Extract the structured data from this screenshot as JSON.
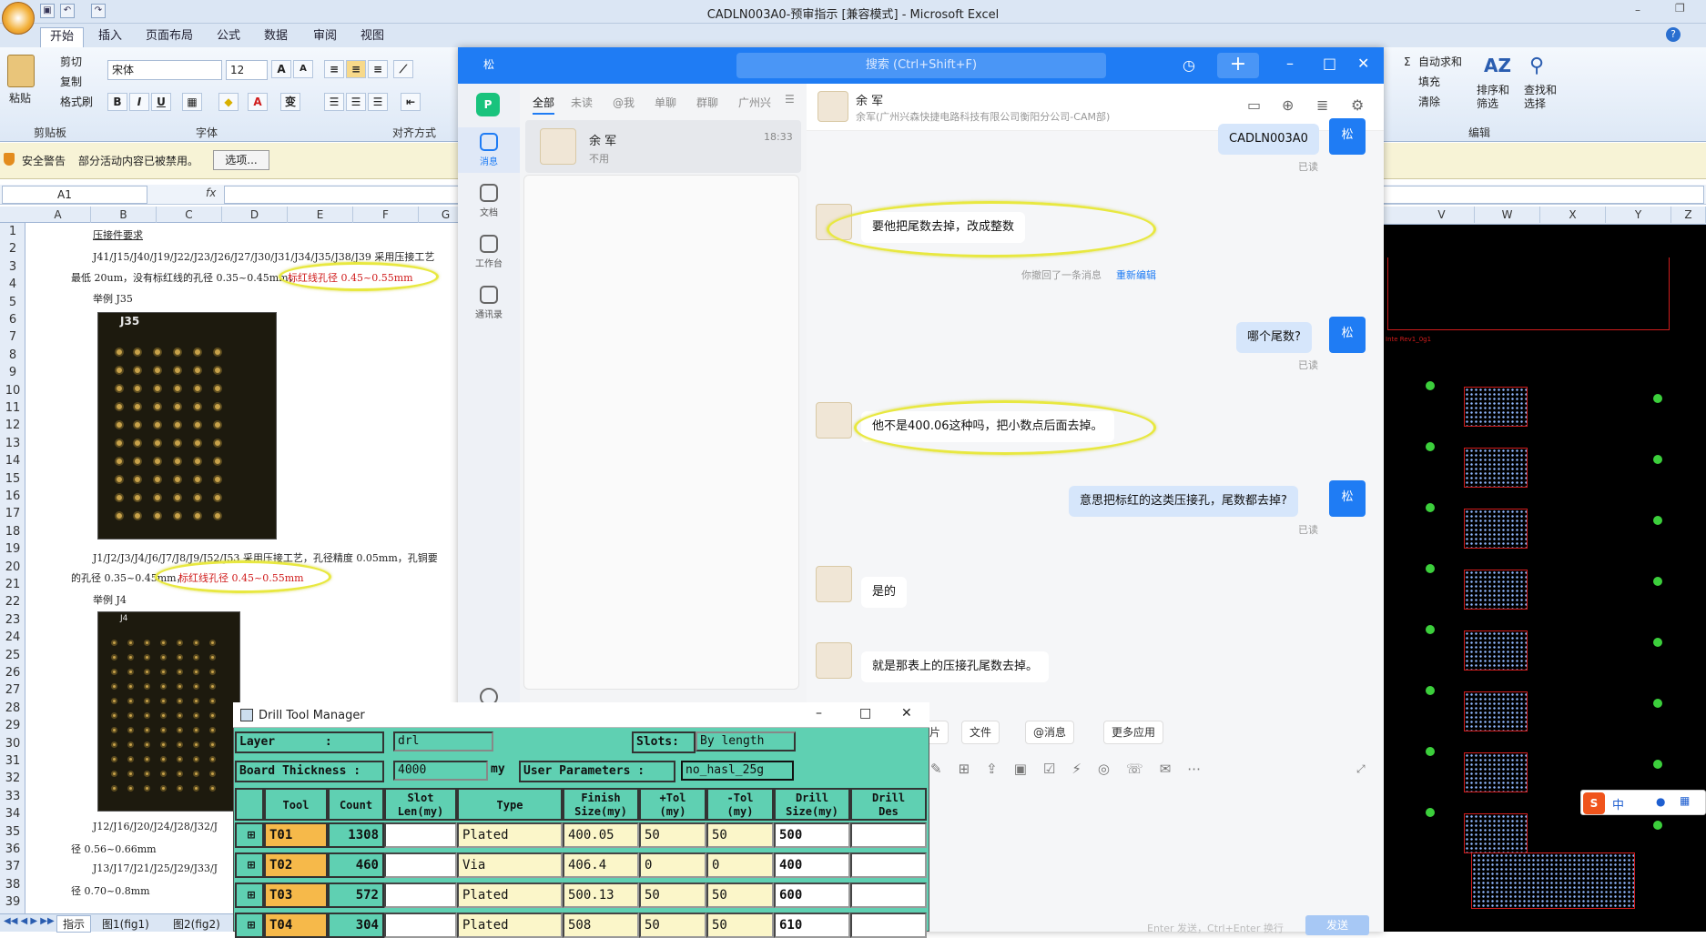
{
  "excel": {
    "title": "CADLN003A0-预审指示 [兼容模式] - Microsoft Excel",
    "tabs": [
      "开始",
      "插入",
      "页面布局",
      "公式",
      "数据",
      "审阅",
      "视图"
    ],
    "clipboard": {
      "paste": "粘贴",
      "cut": "剪切",
      "copy": "复制",
      "painter": "格式刷",
      "group": "剪贴板"
    },
    "font": {
      "name": "宋体",
      "size": "12",
      "group": "字体"
    },
    "align_group": "对齐方式",
    "editing": {
      "autosum": "自动求和",
      "fill": "填充",
      "clear": "清除",
      "sort": "排序和\n筛选",
      "find": "查找和\n选择",
      "group": "编辑"
    },
    "security": {
      "label": "安全警告",
      "msg": "部分活动内容已被禁用。",
      "btn": "选项..."
    },
    "namebox": "A1",
    "fx": "fx",
    "columns": [
      "A",
      "B",
      "C",
      "D",
      "E",
      "F",
      "G"
    ],
    "right_columns": [
      "V",
      "W",
      "X",
      "Y",
      "Z"
    ],
    "rows": [
      "1",
      "2",
      "3",
      "4",
      "5",
      "6",
      "7",
      "8",
      "9",
      "10",
      "11",
      "12",
      "13",
      "14",
      "15",
      "16",
      "17",
      "18",
      "19",
      "20",
      "21",
      "22",
      "23",
      "24",
      "25",
      "26",
      "27",
      "28",
      "29",
      "30",
      "31",
      "32",
      "33",
      "34",
      "35",
      "36",
      "37",
      "38",
      "39"
    ],
    "cells": {
      "r1": "压接件要求",
      "r2": "J41/J15/J40/J19/J22/J23/J26/J27/J30/J31/J34/J35/J38/J39 采用压接工艺",
      "r3a": "最低 20um，没有标红线的孔径 0.35~0.45mm，",
      "r3b": "标红线孔径 0.45~0.55mm",
      "r4": "举例 J35",
      "r19": "J1/J2/J3/J4/J6/J7/J8/J9/J52/J53 采用压接工艺，孔径精度 0.05mm，孔铜要",
      "r20a": "的孔径 0.35~0.45mm，",
      "r20b": "标红线孔径 0.45~0.55mm",
      "r21": "举例 J4",
      "r35": "J12/J16/J20/J24/J28/J32/J",
      "r36": "径 0.56~0.66mm",
      "r37": "J13/J17/J21/J25/J29/J33/J",
      "r38": "径 0.70~0.8mm"
    },
    "pcb1_label": "J35",
    "pcb2_label": "J4",
    "sheets": [
      "指示",
      "图1(fig1)",
      "图2(fig2)"
    ]
  },
  "chat": {
    "search_placeholder": "搜索 (Ctrl+Shift+F)",
    "logo": "松",
    "nav": [
      "消息",
      "文档",
      "工作台",
      "通讯录"
    ],
    "list_tabs": [
      "全部",
      "未读",
      "@我",
      "单聊",
      "群聊",
      "广州兴"
    ],
    "contact": {
      "name": "余 军",
      "preview": "不用",
      "time": "18:33"
    },
    "header": {
      "name": "余 军",
      "org": "余军(广州兴森快捷电路科技有限公司衡阳分公司-CAM部)"
    },
    "messages": [
      {
        "from": "me",
        "text": "CADLN003A0",
        "status": "已读"
      },
      {
        "from": "other",
        "text": "要他把尾数去掉，改成整数"
      },
      {
        "from": "system",
        "text": "你撤回了一条消息",
        "link": "重新编辑"
      },
      {
        "from": "me",
        "text": "哪个尾数?",
        "status": "已读"
      },
      {
        "from": "other",
        "text": "他不是400.06这种吗，把小数点后面去掉。"
      },
      {
        "from": "me",
        "text": "意思把标红的这类压接孔，尾数都去掉?",
        "status": "已读"
      },
      {
        "from": "other",
        "text": "是的"
      },
      {
        "from": "other",
        "text": "就是那表上的压接孔尾数去掉。"
      }
    ],
    "me_avatar": "松",
    "tools": [
      "图片",
      "文件",
      "@消息",
      "更多应用"
    ],
    "input_hint": "Enter 发送，Ctrl+Enter 换行",
    "send": "发送"
  },
  "drill": {
    "title": "Drill Tool Manager",
    "layer_label": "Layer       :",
    "layer": "drl",
    "slots_label": "Slots:",
    "slots": "By length",
    "thick_label": "Board Thickness :",
    "thick": "4000",
    "thick_unit": "my",
    "user_label": "User Parameters :",
    "user": "no_hasl_25g",
    "headers": [
      "Tool",
      "Count",
      "Slot\nLen(my)",
      "Type",
      "Finish\nSize(my)",
      "+Tol\n(my)",
      "-Tol\n(my)",
      "Drill\nSize(my)",
      "Drill\nDes"
    ],
    "rows": [
      {
        "tool": "T01",
        "count": "1308",
        "type": "Plated",
        "finish": "400.05",
        "ptol": "50",
        "mtol": "50",
        "drill": "500"
      },
      {
        "tool": "T02",
        "count": "460",
        "type": "Via",
        "finish": "406.4",
        "ptol": "0",
        "mtol": "0",
        "drill": "400"
      },
      {
        "tool": "T03",
        "count": "572",
        "type": "Plated",
        "finish": "500.13",
        "ptol": "50",
        "mtol": "50",
        "drill": "600"
      },
      {
        "tool": "T04",
        "count": "304",
        "type": "Plated",
        "finish": "508",
        "ptol": "50",
        "mtol": "50",
        "drill": "610"
      }
    ]
  },
  "cam": {
    "label": "Inte Rev1_0g1"
  },
  "ime": {
    "label": "中"
  }
}
